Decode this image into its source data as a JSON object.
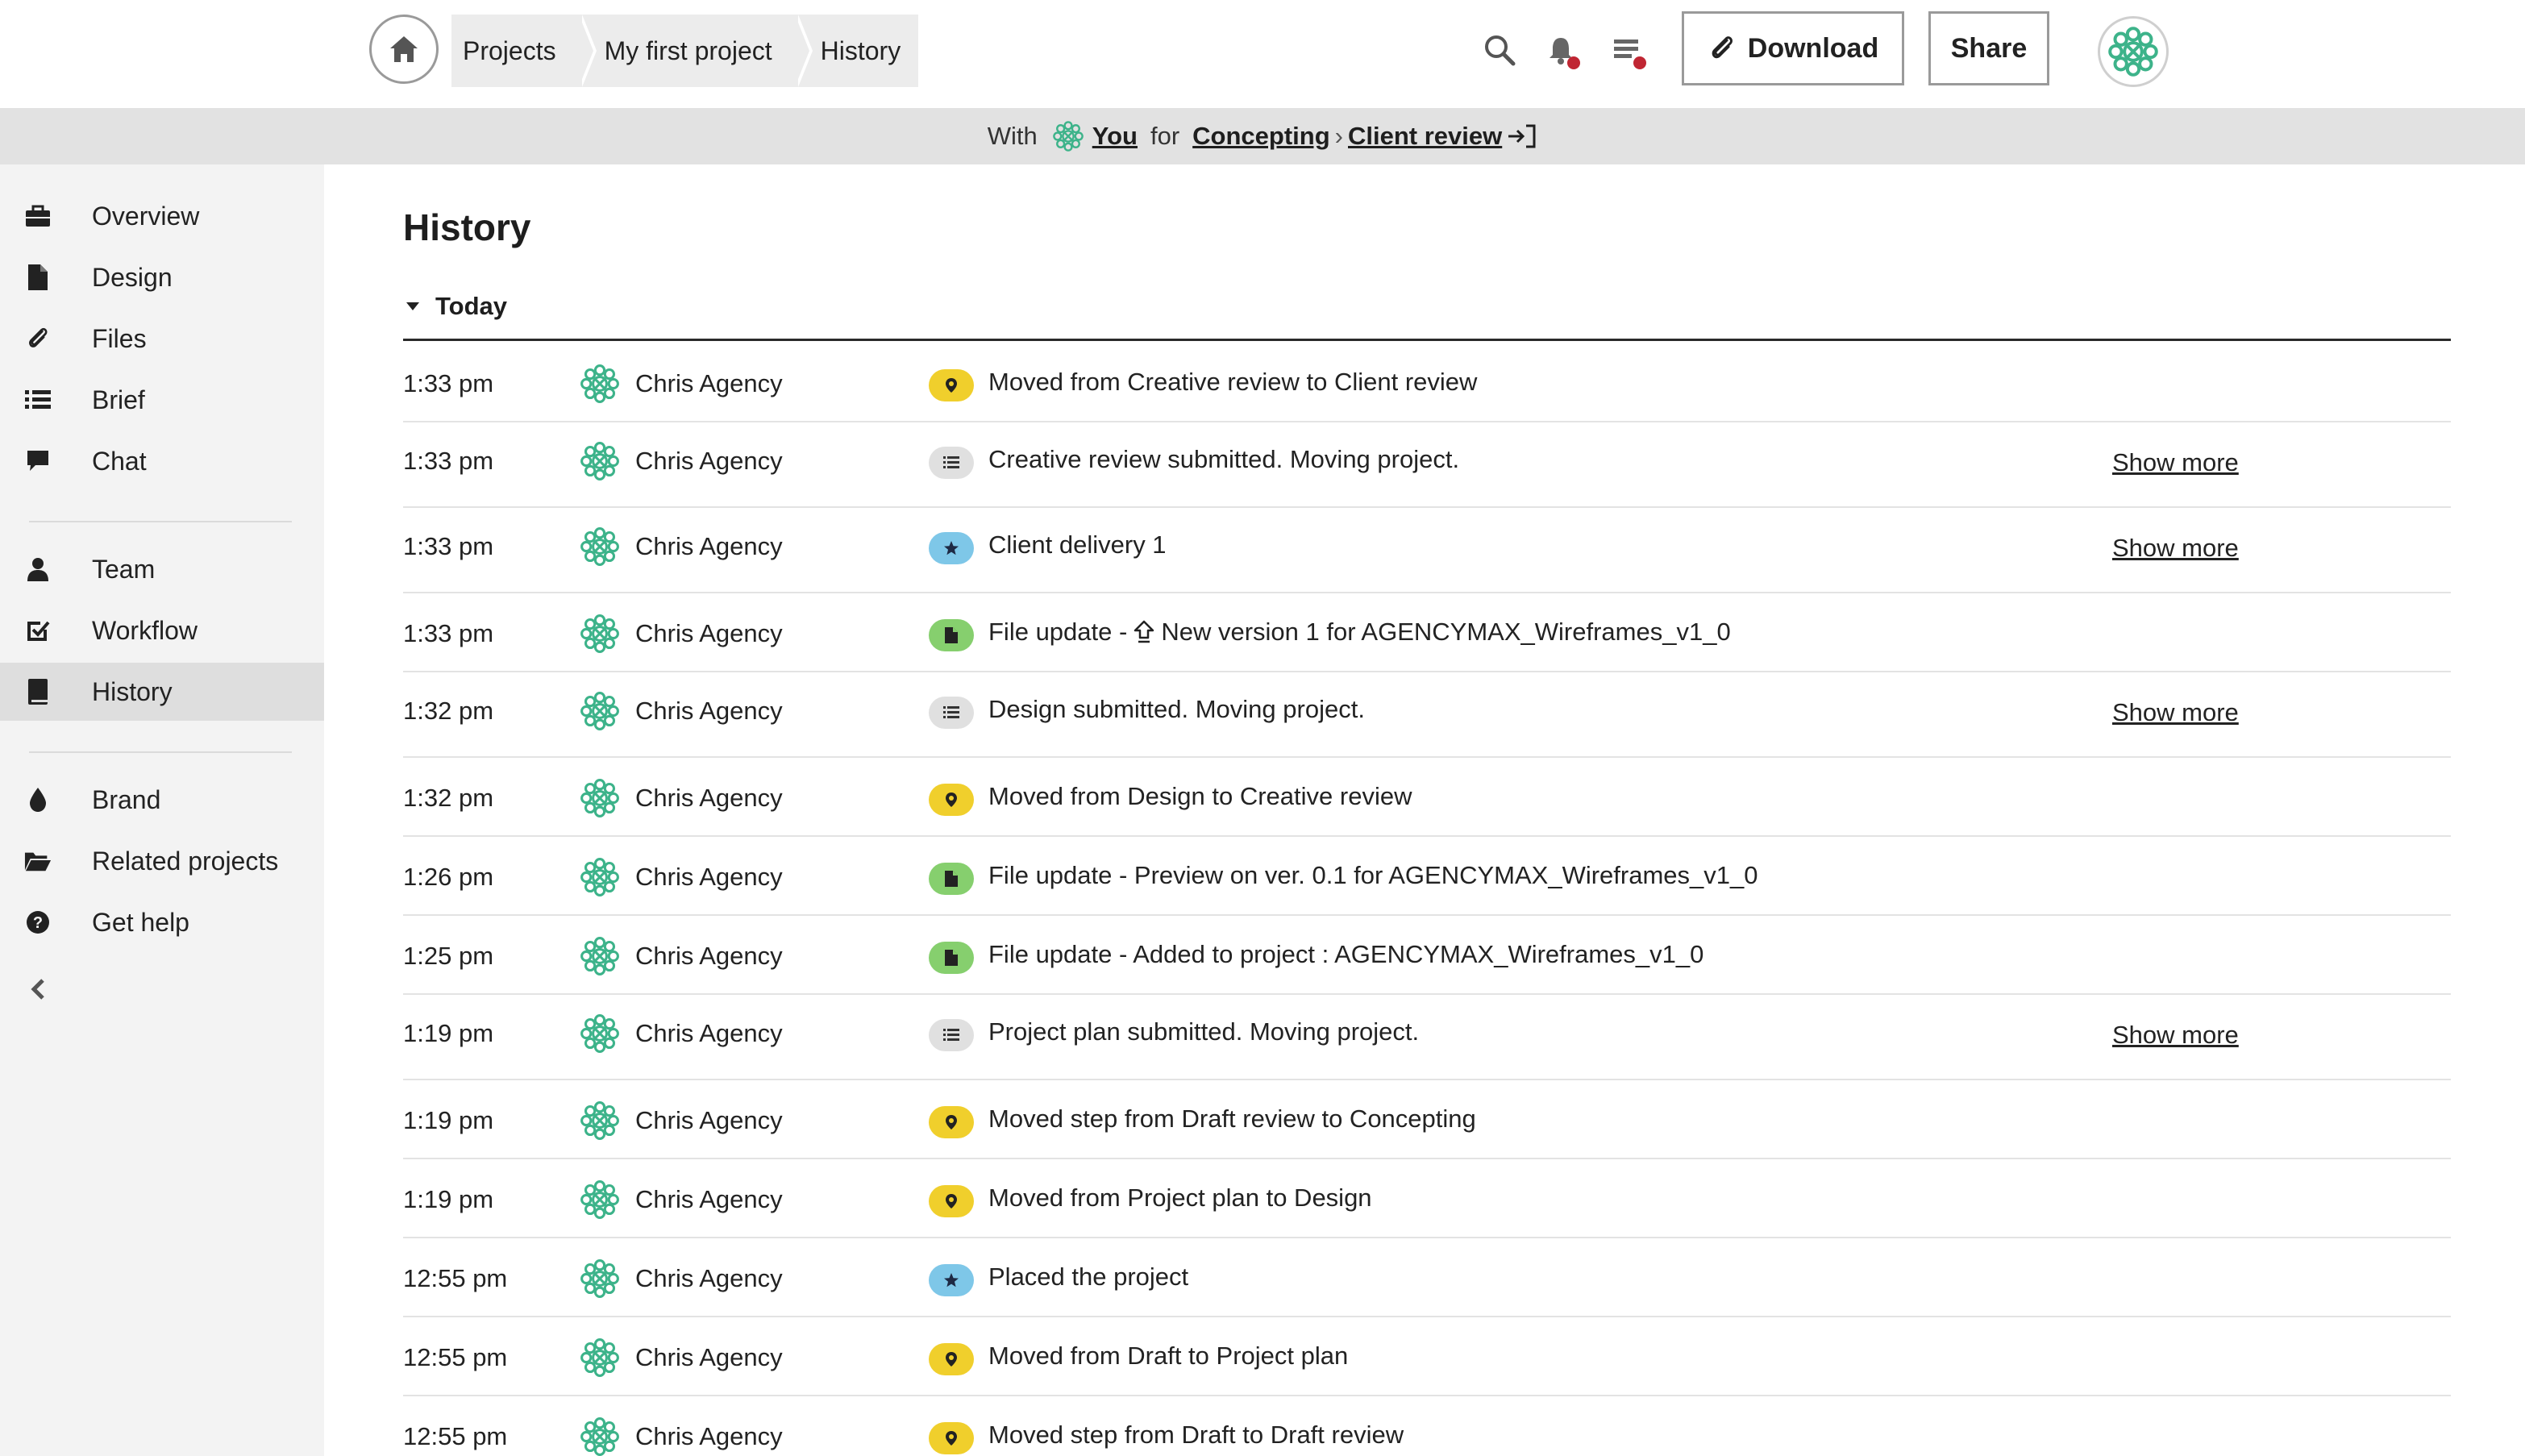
{
  "breadcrumb": [
    "Projects",
    "My first project",
    "History"
  ],
  "header": {
    "download_label": "Download",
    "share_label": "Share"
  },
  "status": {
    "with_label": "With",
    "user": "You",
    "for_label": "for",
    "phase": "Concepting",
    "step": "Client review"
  },
  "sidebar": {
    "items": [
      {
        "label": "Overview",
        "icon": "briefcase-icon"
      },
      {
        "label": "Design",
        "icon": "document-icon"
      },
      {
        "label": "Files",
        "icon": "paperclip-icon"
      },
      {
        "label": "Brief",
        "icon": "list-icon"
      },
      {
        "label": "Chat",
        "icon": "chat-bubble-icon"
      },
      {
        "label": "Team",
        "icon": "person-icon"
      },
      {
        "label": "Workflow",
        "icon": "checkbox-icon"
      },
      {
        "label": "History",
        "icon": "book-icon"
      },
      {
        "label": "Brand",
        "icon": "droplet-icon"
      },
      {
        "label": "Related projects",
        "icon": "folder-open-icon"
      },
      {
        "label": "Get help",
        "icon": "question-circle-icon"
      }
    ],
    "active": "History"
  },
  "main": {
    "title": "History",
    "group": "Today",
    "show_more_label": "Show more",
    "rows": [
      {
        "time": "1:33 pm",
        "user": "Chris Agency",
        "type": "pin",
        "message": "Moved from Creative review to Client review",
        "show_more": false
      },
      {
        "time": "1:33 pm",
        "user": "Chris Agency",
        "type": "list",
        "message": "Creative review submitted. Moving project.",
        "show_more": true
      },
      {
        "time": "1:33 pm",
        "user": "Chris Agency",
        "type": "star",
        "message": "Client delivery 1",
        "show_more": true
      },
      {
        "time": "1:33 pm",
        "user": "Chris Agency",
        "type": "file",
        "message": "File update - ",
        "message_suffix": "New version 1 for AGENCYMAX_Wireframes_v1_0",
        "show_more": false
      },
      {
        "time": "1:32 pm",
        "user": "Chris Agency",
        "type": "list",
        "message": "Design submitted. Moving project.",
        "show_more": true
      },
      {
        "time": "1:32 pm",
        "user": "Chris Agency",
        "type": "pin",
        "message": "Moved from Design to Creative review",
        "show_more": false
      },
      {
        "time": "1:26 pm",
        "user": "Chris Agency",
        "type": "file",
        "message": "File update - Preview on ver. 0.1 for AGENCYMAX_Wireframes_v1_0",
        "show_more": false
      },
      {
        "time": "1:25 pm",
        "user": "Chris Agency",
        "type": "file",
        "message": "File update - Added to project : AGENCYMAX_Wireframes_v1_0",
        "show_more": false
      },
      {
        "time": "1:19 pm",
        "user": "Chris Agency",
        "type": "list",
        "message": "Project plan submitted. Moving project.",
        "show_more": true
      },
      {
        "time": "1:19 pm",
        "user": "Chris Agency",
        "type": "pin",
        "message": "Moved step from Draft review to Concepting",
        "show_more": false
      },
      {
        "time": "1:19 pm",
        "user": "Chris Agency",
        "type": "pin",
        "message": "Moved from Project plan to Design",
        "show_more": false
      },
      {
        "time": "12:55 pm",
        "user": "Chris Agency",
        "type": "star",
        "message": "Placed the project",
        "show_more": false
      },
      {
        "time": "12:55 pm",
        "user": "Chris Agency",
        "type": "pin",
        "message": "Moved from Draft to Project plan",
        "show_more": false
      },
      {
        "time": "12:55 pm",
        "user": "Chris Agency",
        "type": "pin",
        "message": "Moved step from Draft to Draft review",
        "show_more": false
      }
    ]
  },
  "colors": {
    "pin": "#f0cf2c",
    "list": "#e0e0e0",
    "star": "#7ec7e8",
    "file": "#86cf6e",
    "avatar": "#3db38a",
    "notification_dot": "#c02633"
  }
}
